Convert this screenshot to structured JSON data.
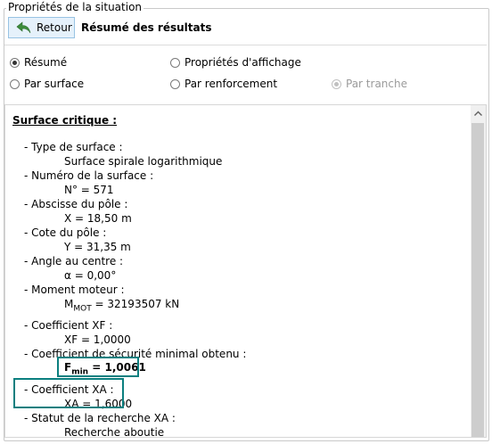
{
  "group_title": "Propriétés de la situation",
  "toolbar": {
    "back_label": "Retour",
    "header_title": "Résumé des résultats"
  },
  "options": {
    "resume": "Résumé",
    "affichage": "Propriétés d'affichage",
    "surface": "Par surface",
    "renforcement": "Par renforcement",
    "tranche": "Par tranche"
  },
  "results": {
    "title": "Surface critique :",
    "type_label": "- Type de surface :",
    "type_value": "Surface spirale logarithmique",
    "num_label": "- Numéro de la surface :",
    "num_value": "N° = 571",
    "abscisse_label": "- Abscisse du pôle :",
    "abscisse_value": "X = 18,50 m",
    "cote_label": "- Cote du pôle :",
    "cote_value": "Y = 31,35 m",
    "angle_label": "- Angle au centre :",
    "angle_value": "α = 0,00°",
    "moment_label": "- Moment moteur :",
    "moment_sym": "M",
    "moment_sub": "MOT",
    "moment_value": " = 32193507 kN",
    "xf_label": "- Coefficient XF :",
    "xf_value": "XF = 1,0000",
    "secu_label": "- Coefficient de sécurité minimal obtenu :",
    "fmin_sym": "F",
    "fmin_sub": "min",
    "fmin_value": " = 1,0061",
    "xa_label": "- Coefficient XA :",
    "xa_value": "XA = 1,6000",
    "statut_label": "- Statut de la recherche XA :",
    "statut_value": "Recherche aboutie"
  }
}
